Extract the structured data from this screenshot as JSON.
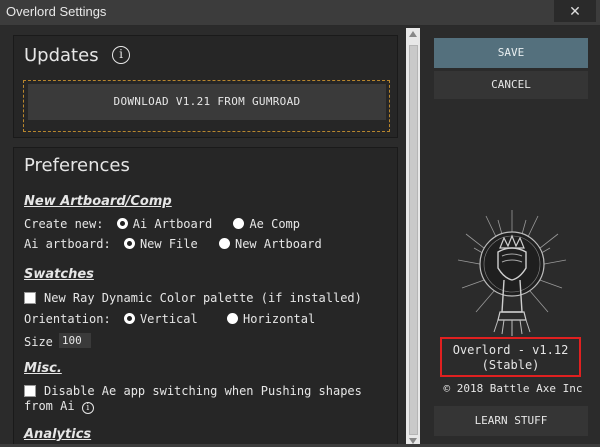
{
  "window": {
    "title": "Overlord Settings",
    "close_glyph": "✕"
  },
  "updates": {
    "title": "Updates",
    "info_glyph": "i",
    "download_label": "DOWNLOAD V1.21 FROM GUMROAD"
  },
  "preferences": {
    "title": "Preferences",
    "new_artboard": {
      "heading": "New Artboard/Comp",
      "create_new_label": "Create new:",
      "create_options": [
        "Ai Artboard",
        "Ae Comp"
      ],
      "create_selected": "Ai Artboard",
      "ai_artboard_label": "Ai artboard:",
      "ai_options": [
        "New File",
        "New Artboard"
      ],
      "ai_selected": "New File"
    },
    "swatches": {
      "heading": "Swatches",
      "checkbox_label": "New Ray Dynamic Color palette (if installed)",
      "checked": false,
      "orientation_label": "Orientation:",
      "orientation_options": [
        "Vertical",
        "Horizontal"
      ],
      "orientation_selected": "Vertical",
      "size_label": "Size",
      "size_value": "100"
    },
    "misc": {
      "heading": "Misc.",
      "checkbox_line1": "Disable Ae app switching when Pushing shapes",
      "checkbox_line2": "from Ai",
      "info_glyph": "i",
      "checked": false
    },
    "analytics": {
      "heading": "Analytics"
    }
  },
  "sidebar": {
    "save_label": "SAVE",
    "cancel_label": "CANCEL",
    "version_line1": "Overlord - v1.12",
    "version_line2": "(Stable)",
    "copyright": "© 2018 Battle Axe Inc",
    "learn_label": "LEARN STUFF"
  },
  "colors": {
    "background": "#2b2b2b",
    "panel": "#262626",
    "save_accent": "#54707d",
    "dashed_border": "#b8862d",
    "highlight_red": "#e02020"
  }
}
